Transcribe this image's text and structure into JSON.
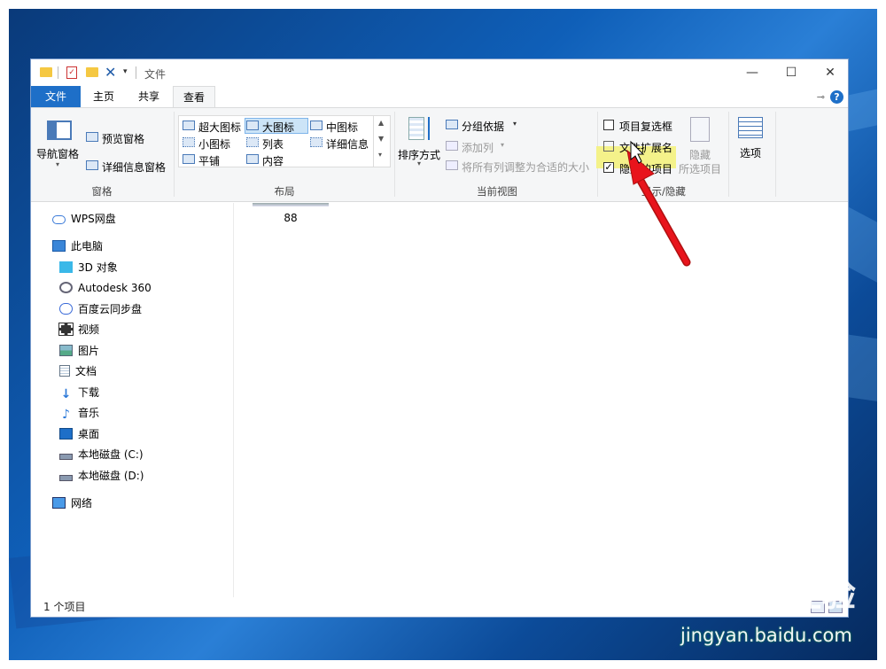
{
  "window": {
    "title": "文件"
  },
  "window_controls": {
    "minimize": "—",
    "maximize": "☐",
    "close": "✕"
  },
  "tabs": [
    "文件",
    "主页",
    "共享",
    "查看"
  ],
  "active_tab": "查看",
  "ribbon": {
    "panes": {
      "nav_pane": "导航窗格",
      "preview_pane": "预览窗格",
      "details_pane": "详细信息窗格",
      "label": "窗格"
    },
    "layout": {
      "items": [
        "超大图标",
        "大图标",
        "中图标",
        "小图标",
        "列表",
        "详细信息",
        "平铺",
        "内容"
      ],
      "selected": "大图标",
      "label": "布局"
    },
    "current_view": {
      "sort_by": "排序方式",
      "group_by": "分组依据",
      "add_columns": "添加列",
      "fit_columns": "将所有列调整为合适的大小",
      "label": "当前视图"
    },
    "show_hide": {
      "item_checkboxes": "项目复选框",
      "file_extensions": "文件扩展名",
      "hidden_items": "隐藏的项目",
      "item_checkboxes_checked": false,
      "file_extensions_checked": false,
      "hidden_items_checked": true,
      "hide_selected_line1": "隐藏",
      "hide_selected_line2": "所选项目",
      "label": "显示/隐藏"
    },
    "options": {
      "label": "选项"
    }
  },
  "nav": {
    "items": [
      {
        "label": "WPS网盘",
        "icon": "cloud-icon",
        "indent": 0
      },
      {
        "label": "此电脑",
        "icon": "computer-icon",
        "indent": 0
      },
      {
        "label": "3D 对象",
        "icon": "cube-icon",
        "indent": 1
      },
      {
        "label": "Autodesk 360",
        "icon": "autodesk-icon",
        "indent": 1
      },
      {
        "label": "百度云同步盘",
        "icon": "baidu-cloud-icon",
        "indent": 1
      },
      {
        "label": "视频",
        "icon": "video-icon",
        "indent": 1
      },
      {
        "label": "图片",
        "icon": "picture-icon",
        "indent": 1
      },
      {
        "label": "文档",
        "icon": "document-icon",
        "indent": 1
      },
      {
        "label": "下载",
        "icon": "download-icon",
        "indent": 1
      },
      {
        "label": "音乐",
        "icon": "music-icon",
        "indent": 1
      },
      {
        "label": "桌面",
        "icon": "desktop-icon",
        "indent": 1
      },
      {
        "label": "本地磁盘 (C:)",
        "icon": "drive-c-icon",
        "indent": 1
      },
      {
        "label": "本地磁盘 (D:)",
        "icon": "drive-d-icon",
        "indent": 1
      },
      {
        "label": "网络",
        "icon": "network-icon",
        "indent": 0
      }
    ]
  },
  "content": {
    "file_name": "88"
  },
  "status": {
    "item_count": "1 个项目"
  },
  "watermark": {
    "logo": "Baidu经验",
    "url": "jingyan.baidu.com"
  },
  "colors": {
    "accent": "#1e6fc8",
    "highlight": "#f4f28a",
    "arrow": "#e8141c"
  }
}
